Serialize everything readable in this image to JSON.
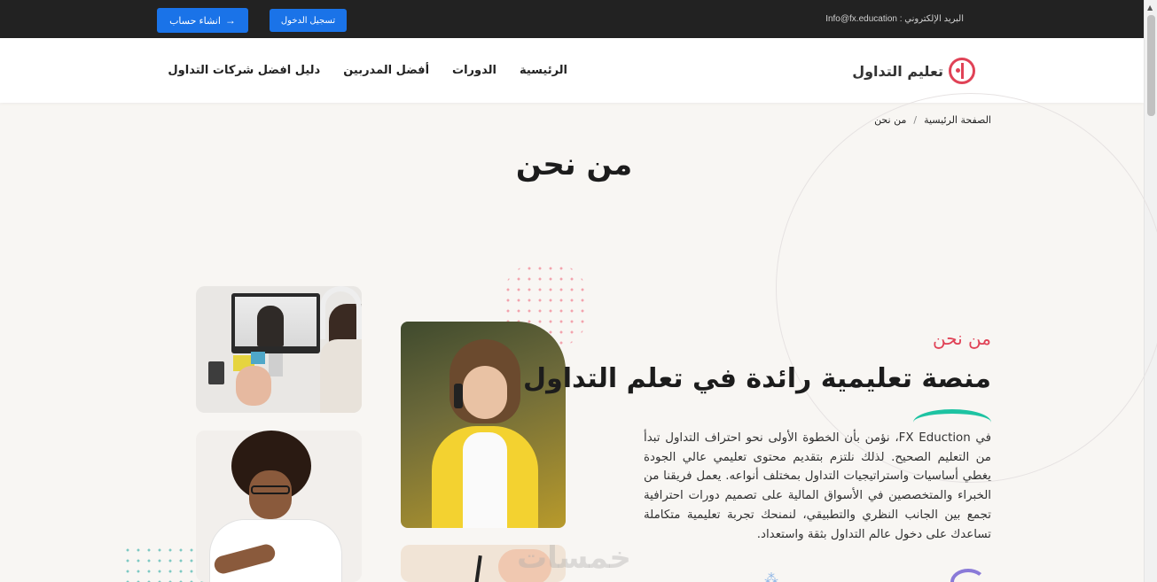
{
  "topbar": {
    "email": "البريد الإلكتروني : Info@fx.education",
    "login_label": "تسجيل الدخول",
    "register_label": "انشاء حساب",
    "register_icon": "arrow-right-icon"
  },
  "navbar": {
    "logo_text": "تعليم التداول",
    "items": [
      {
        "label": "الرئيسية"
      },
      {
        "label": "الدورات"
      },
      {
        "label": "أفضل المدربين"
      },
      {
        "label": "دليل افضل شركات التداول"
      }
    ]
  },
  "breadcrumb": {
    "home": "الصفحة الرئيسية",
    "separator": "/",
    "current": "من نحن"
  },
  "page_title": "من نحن",
  "about": {
    "label": "من نحن",
    "heading": "منصة تعليمية رائدة في تعلم التداول",
    "paragraph": "في FX Eduction، نؤمن بأن الخطوة الأولى نحو احتراف التداول تبدأ من التعليم الصحيح. لذلك نلتزم بتقديم محتوى تعليمي عالي الجودة يغطي أساسيات واستراتيجيات التداول بمختلف أنواعه. يعمل فريقنا من الخبراء والمتخصصين في الأسواق المالية على تصميم دورات احترافية تجمع بين الجانب النظري والتطبيقي، لنمنحك تجربة تعليمية متكاملة تساعدك على دخول عالم التداول بثقة واستعداد."
  },
  "watermark": "خمسات",
  "colors": {
    "accent": "#e04256",
    "primary_button": "#1a73e8",
    "teal": "#1ec3a2",
    "topbar": "#222222"
  }
}
